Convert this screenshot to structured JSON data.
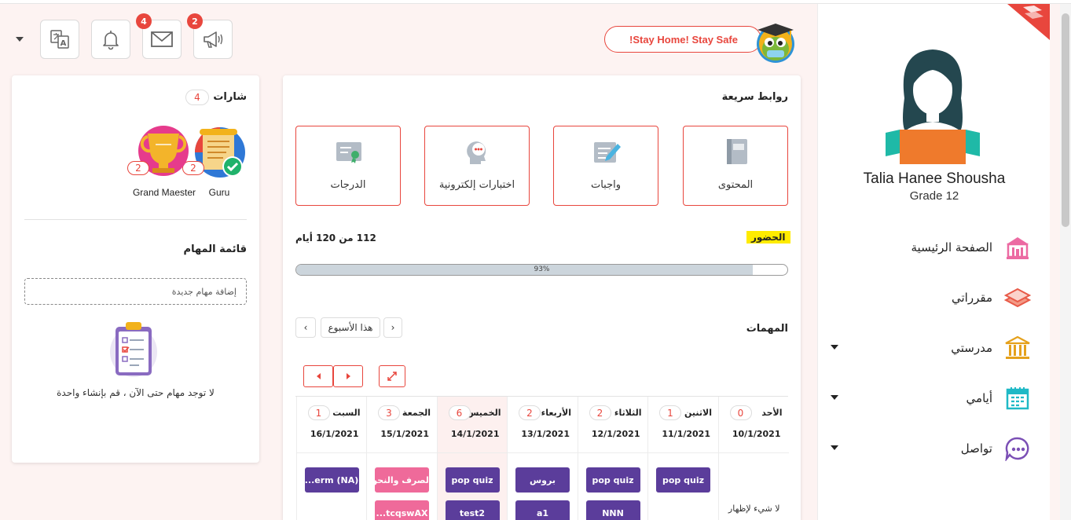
{
  "header": {
    "notices_badge": "2",
    "mail_badge": "4",
    "stay_home": "!Stay Home! Stay Safe"
  },
  "user": {
    "name": "Talia Hanee Shousha",
    "grade": "Grade 12"
  },
  "nav": [
    {
      "label": "الصفحة الرئيسية",
      "icon": "school-building-icon"
    },
    {
      "label": "مقرراتي",
      "icon": "books-stack-icon"
    },
    {
      "label": "مدرستي",
      "icon": "institution-columns-icon"
    },
    {
      "label": "أيامي",
      "icon": "calendar-icon"
    },
    {
      "label": "تواصل",
      "icon": "chat-bubble-icon"
    }
  ],
  "badges": {
    "title": "شارات",
    "count": "4",
    "items": [
      {
        "name": "Guru",
        "count": "2"
      },
      {
        "name": "Grand Maester",
        "count": "2"
      }
    ]
  },
  "todo": {
    "title": "قائمة المهام",
    "placeholder": "إضافة مهام جديدة",
    "empty": "لا توجد مهام حتى الآن ، قم بإنشاء واحدة"
  },
  "quick_links": {
    "title": "روابط سريعة",
    "items": [
      {
        "label": "المحتوى",
        "icon": "book-icon"
      },
      {
        "label": "واجبات",
        "icon": "homework-pen-icon"
      },
      {
        "label": "اختبارات إلكترونية",
        "icon": "quiz-head-icon"
      },
      {
        "label": "الدرجات",
        "icon": "certificate-icon"
      }
    ]
  },
  "attendance": {
    "label": "الحضور",
    "summary": "112 من 120 أيام",
    "percent_text": "93%",
    "fraction": 0.93
  },
  "tasks": {
    "title": "المهمات",
    "this_week": "هذا الأسبوع",
    "prev_symbol": "‹",
    "next_symbol": "›",
    "empty_day": "لا شيء لإظهار",
    "days": [
      {
        "name": "الأحد",
        "count": "0",
        "date": "10/1/2021",
        "tasks": []
      },
      {
        "name": "الاثنين",
        "count": "1",
        "date": "11/1/2021",
        "tasks": [
          {
            "label": "pop quiz",
            "color": "#5b3d9b"
          }
        ]
      },
      {
        "name": "الثلاثاء",
        "count": "2",
        "date": "12/1/2021",
        "tasks": [
          {
            "label": "pop quiz",
            "color": "#5b3d9b"
          },
          {
            "label": "NNN",
            "color": "#5b3d9b"
          }
        ]
      },
      {
        "name": "الأربعاء",
        "count": "2",
        "date": "13/1/2021",
        "tasks": [
          {
            "label": "بروس",
            "color": "#5b3d9b"
          },
          {
            "label": "a1",
            "color": "#5b3d9b"
          }
        ]
      },
      {
        "name": "الخميس",
        "count": "6",
        "date": "14/1/2021",
        "tasks": [
          {
            "label": "pop quiz",
            "color": "#5b3d9b"
          },
          {
            "label": "test2",
            "color": "#5b3d9b"
          }
        ]
      },
      {
        "name": "الجمعة",
        "count": "3",
        "date": "15/1/2021",
        "tasks": [
          {
            "label": "الصرف والنحو",
            "color": "#ef6a9a"
          },
          {
            "label": "...tcqswAX",
            "color": "#ef6a9a"
          }
        ]
      },
      {
        "name": "السبت",
        "count": "1",
        "date": "16/1/2021",
        "tasks": [
          {
            "label": "...erm (NA)",
            "color": "#5b3d9b"
          }
        ]
      }
    ]
  },
  "colors": {
    "accent": "#e8463d",
    "purple_task": "#5b3d9b",
    "pink_task": "#ef6a9a",
    "attendance_highlight": "#ffeb00"
  }
}
